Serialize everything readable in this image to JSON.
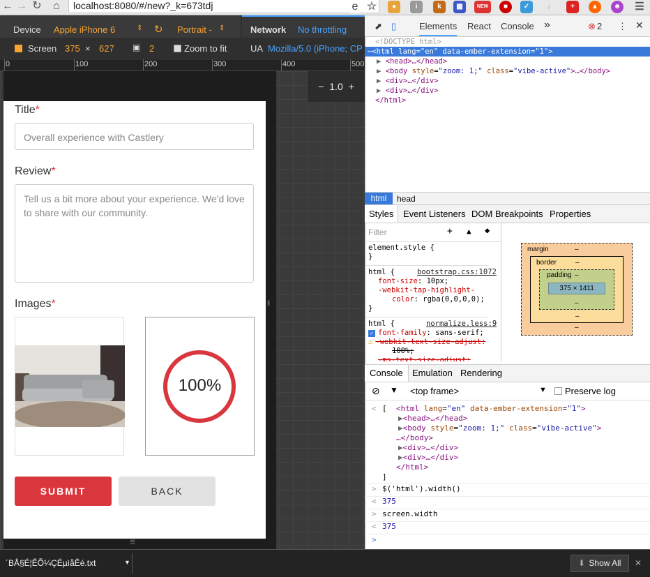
{
  "browser": {
    "url": "localhost:8080/#/new?_k=673tdj",
    "new_badge": "NEW",
    "k_label": "k"
  },
  "device_toolbar": {
    "device_label": "Device",
    "device_value": "Apple iPhone 6",
    "orientation_value": "Portrait -",
    "network_label": "Network",
    "network_value": "No throttling",
    "screen_label": "Screen",
    "screen_width": "375",
    "screen_times": "×",
    "screen_height": "627",
    "dpr": "2",
    "zoom_to_fit": "Zoom to fit",
    "ua_label": "UA",
    "ua_value": "Mozilla/5.0 (iPhone; CP"
  },
  "ruler": {
    "labels": [
      "0",
      "100",
      "200",
      "300",
      "400",
      "500"
    ]
  },
  "zoom": {
    "minus": "−",
    "value": "1.0",
    "plus": "+"
  },
  "form": {
    "title_label": "Title",
    "title_placeholder": "Overall experience with Castlery",
    "review_label": "Review",
    "review_placeholder": "Tell us a bit more about your experience. We'd love to share with our community.",
    "images_label": "Images",
    "required_mark": "*",
    "upload_progress": "100%",
    "upload_progress_value": 1.0,
    "submit": "SUBMIT",
    "back": "BACK"
  },
  "devtools": {
    "tabs": [
      "Elements",
      "React",
      "Console"
    ],
    "more": "»",
    "error_count": "2",
    "dom": {
      "doctype": "<!DOCTYPE html>",
      "html_open_tag": "html",
      "lang_attr": "lang",
      "lang_val": "\"en\"",
      "ext_attr": "data-ember-extension",
      "ext_val": "\"1\"",
      "head": "<head>…</head>",
      "body_tag": "body",
      "style_attr": "style",
      "style_val": "\"zoom: 1;\"",
      "class_attr": "class",
      "class_val": "\"vibe-active\"",
      "body_rest": ">…</body>",
      "div1": "<div>…</div>",
      "div2": "<div>…</div>",
      "html_close": "</html>"
    },
    "breadcrumbs": [
      "html",
      "head"
    ],
    "subtabs": [
      "Styles",
      "Event Listeners",
      "DOM Breakpoints",
      "Properties"
    ],
    "filter_placeholder": "Filter",
    "styles": {
      "element_style": "element.style {",
      "close_brace": "}",
      "rule1_selector": "html {",
      "rule1_source": "bootstrap.css:1072",
      "rule1_prop1": "font-size",
      "rule1_val1": "10px;",
      "rule1_prop2": "-webkit-tap-highlight-",
      "rule1_prop2b": "color",
      "rule1_val2": "rgba(0,0,0,0);",
      "rule2_selector": "html {",
      "rule2_source": "normalize.less:9",
      "rule2_prop1": "font-family",
      "rule2_val1": "sans-serif;",
      "rule2_prop2": "-webkit-text-size-adjust:",
      "rule2_val2": "100%;",
      "rule2_prop3": "-ms-text-size-adjust:"
    },
    "box_model": {
      "margin": "margin",
      "border": "border",
      "padding": "padding",
      "dash": "–",
      "content": "375 × 1411"
    },
    "console_tabs": [
      "Console",
      "Emulation",
      "Rendering"
    ],
    "frame": "<top frame>",
    "preserve_log": "Preserve log",
    "console_lines": {
      "bracket_open": "[",
      "bracket_close": "]",
      "cmd1": "$('html').width()",
      "res1": "375",
      "cmd2": "screen.width",
      "res2": "375"
    }
  },
  "download": {
    "filename": "´BÅ§É¦ÊÕ¼ÇÉµìåÊé.txt",
    "show_all": "Show All"
  },
  "colors": {
    "accent_red": "#d9363e",
    "devtools_orange": "#f7a435",
    "devtools_blue": "#4aa3ff"
  }
}
